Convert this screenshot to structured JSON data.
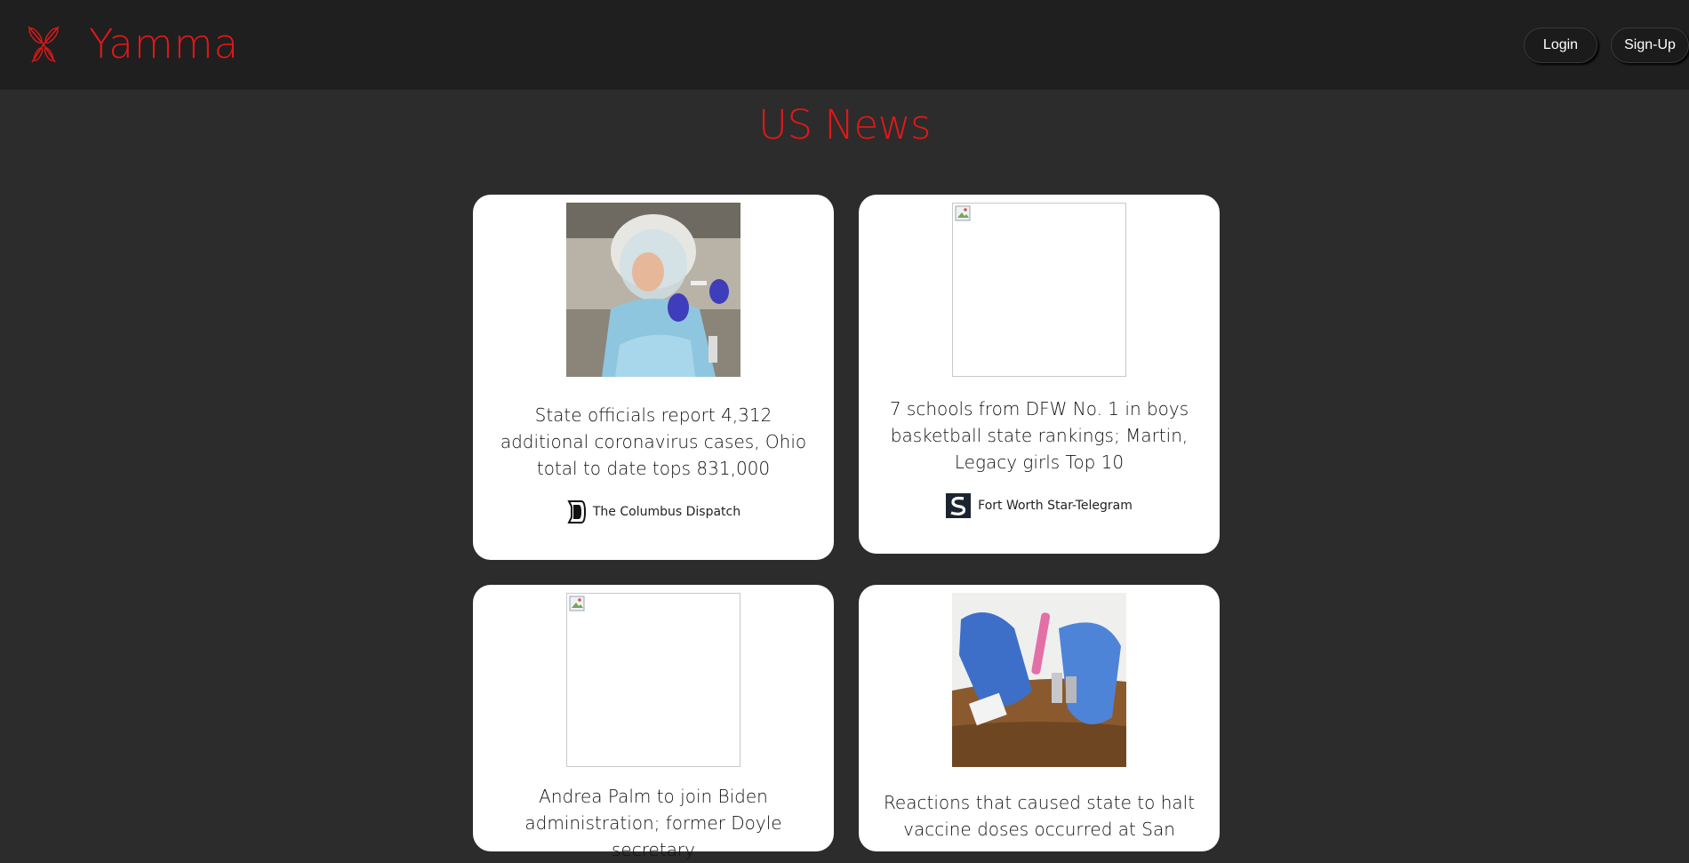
{
  "header": {
    "brand": "Yamma",
    "login_label": "Login",
    "signup_label": "Sign-Up",
    "accent_color": "#e01818"
  },
  "page": {
    "title": "US News"
  },
  "articles": [
    {
      "headline": "State officials report 4,312 additional coronavirus cases, Ohio total to date tops 831,000",
      "source": "The Columbus Dispatch",
      "image": "photo-health-worker",
      "source_icon": "columbus-dispatch-logo-icon"
    },
    {
      "headline": "7 schools from DFW No. 1 in boys basketball state rankings; Martin, Legacy girls Top 10",
      "source": "Fort Worth Star-Telegram",
      "image": "broken-image",
      "source_icon": "star-telegram-logo-icon"
    },
    {
      "headline": "Andrea Palm to join Biden administration; former Doyle secretary",
      "source": "",
      "image": "broken-image"
    },
    {
      "headline": "Reactions that caused state to halt vaccine doses occurred at San",
      "source": "",
      "image": "photo-vaccine-vials"
    }
  ]
}
